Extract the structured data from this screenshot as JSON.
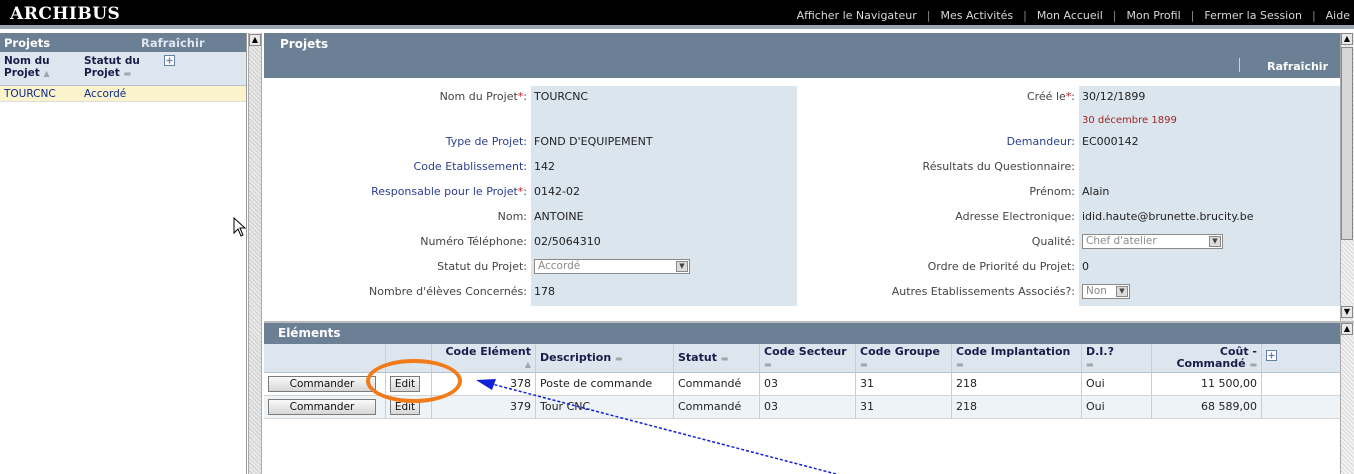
{
  "topbar": {
    "logo": "ARCHIBUS",
    "nav": [
      "Afficher le Navigateur",
      "Mes Activités",
      "Mon Accueil",
      "Mon Profil",
      "Fermer la Session",
      "Aide"
    ]
  },
  "left_panel": {
    "title": "Projets",
    "refresh": "Rafraîchir",
    "columns": [
      "Nom du Projet",
      "Statut du Projet"
    ],
    "rows": [
      {
        "name": "TOURCNC",
        "status": "Accordé"
      }
    ]
  },
  "main_panel": {
    "title": "Projets",
    "refresh": "Rafraîchir",
    "fields": {
      "nom_projet": {
        "label": "Nom du Projet",
        "value": "TOURCNC"
      },
      "cree_le": {
        "label": "Créé le",
        "value": "30/12/1899",
        "note": "30 décembre 1899"
      },
      "type_projet": {
        "label": "Type de Projet:",
        "value": "FOND D'EQUIPEMENT"
      },
      "demandeur": {
        "label": "Demandeur:",
        "value": "EC000142"
      },
      "code_etab": {
        "label": "Code Etablissement:",
        "value": "142"
      },
      "resultats": {
        "label": "Résultats du Questionnaire:",
        "value": ""
      },
      "responsable": {
        "label": "Responsable pour le Projet",
        "value": "0142-02"
      },
      "prenom": {
        "label": "Prénom:",
        "value": "Alain"
      },
      "nom": {
        "label": "Nom:",
        "value": "ANTOINE"
      },
      "email": {
        "label": "Adresse Electronique:",
        "value": "idid.haute@brunette.brucity.be"
      },
      "telephone": {
        "label": "Numéro Téléphone:",
        "value": "02/5064310"
      },
      "qualite": {
        "label": "Qualité:",
        "value": "Chef d'atelier"
      },
      "statut": {
        "label": "Statut du Projet:",
        "value": "Accordé"
      },
      "priorite": {
        "label": "Ordre de Priorité du Projet:",
        "value": "0"
      },
      "eleves": {
        "label": "Nombre d'élèves Concernés:",
        "value": "178"
      },
      "autres": {
        "label": "Autres Etablissements Associés?:",
        "value": "Non"
      }
    }
  },
  "elements_panel": {
    "title": "Eléments",
    "columns": [
      "Code Elément",
      "Description",
      "Statut",
      "Code Secteur",
      "Code Groupe",
      "Code Implantation",
      "D.I.?",
      "Coût - Commandé"
    ],
    "command_label": "Commander",
    "edit_label": "Edit",
    "rows": [
      {
        "code": "378",
        "description": "Poste de commande",
        "statut": "Commandé",
        "secteur": "03",
        "groupe": "31",
        "implantation": "218",
        "di": "Oui",
        "cout": "11 500,00"
      },
      {
        "code": "379",
        "description": "Tour CNC",
        "statut": "Commandé",
        "secteur": "03",
        "groupe": "31",
        "implantation": "218",
        "di": "Oui",
        "cout": "68 589,00"
      }
    ]
  },
  "colors": {
    "header": "#6b7f95",
    "field_bg": "#dbe5ee",
    "highlight_row": "#fbf3cc",
    "annotation_ring": "#f07b18",
    "annotation_arrow": "#1020d8"
  },
  "icons": {
    "add_column": "plus-box-icon",
    "sort": "sort-triangle-icon"
  }
}
